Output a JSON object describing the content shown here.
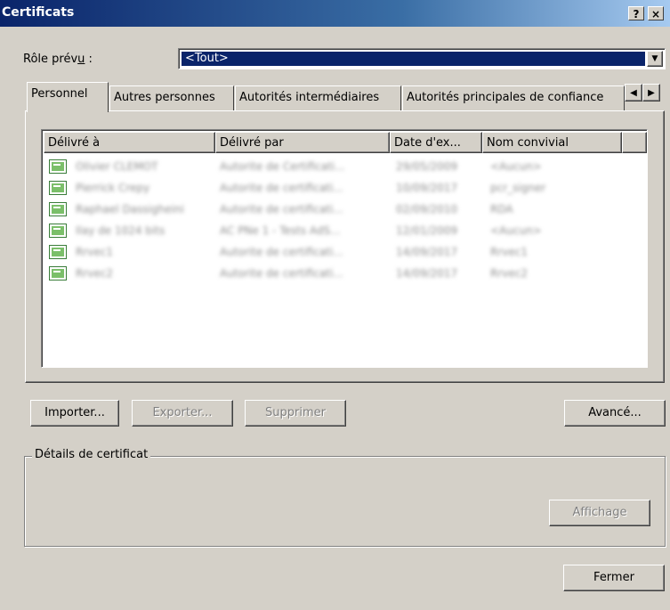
{
  "window": {
    "title": "Certificats",
    "help_button": "?",
    "close_button": "×"
  },
  "role": {
    "label": "Rôle prévu :",
    "selected": "<Tout>"
  },
  "tabs": [
    {
      "label": "Personnel"
    },
    {
      "label": "Autres personnes"
    },
    {
      "label": "Autorités intermédiaires"
    },
    {
      "label": "Autorités principales de confiance"
    }
  ],
  "table": {
    "columns": [
      "Délivré à",
      "Délivré par",
      "Date d'ex...",
      "Nom convivial"
    ],
    "rows": [
      [
        "Olivier CLEMOT",
        "Autorite de Certificati...",
        "29/05/2009",
        "<Aucun>"
      ],
      [
        "Pierrick Crepy",
        "Autorite de certificati...",
        "10/09/2017",
        "pcr_signer"
      ],
      [
        "Raphael Dassigheini",
        "Autorite de certificati...",
        "02/09/2010",
        "RDA"
      ],
      [
        "Ilay de 1024 bits",
        "AC PNe 1 - Tests AdS...",
        "12/01/2009",
        "<Aucun>"
      ],
      [
        "Rrvec1",
        "Autorite de certificati...",
        "14/09/2017",
        "Rrvec1"
      ],
      [
        "Rrvec2",
        "Autorite de certificati...",
        "14/09/2017",
        "Rrvec2"
      ]
    ]
  },
  "buttons": {
    "import": "Importer...",
    "export": "Exporter...",
    "delete": "Supprimer",
    "advanced": "Avancé...",
    "view": "Affichage",
    "close": "Fermer"
  },
  "details": {
    "label": "Détails de certificat"
  }
}
